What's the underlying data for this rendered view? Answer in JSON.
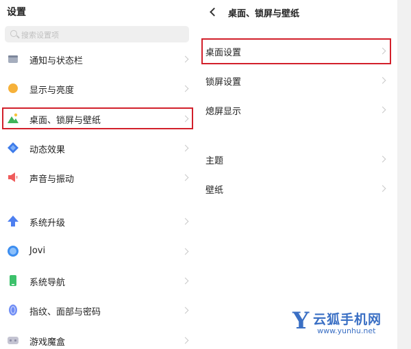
{
  "settings": {
    "title": "设置",
    "search_placeholder": "搜索设置项",
    "items": [
      {
        "label": "通知与状态栏",
        "icon": "notification-icon",
        "color": "#8a93a6"
      },
      {
        "label": "显示与亮度",
        "icon": "brightness-icon",
        "color": "#f6b13a"
      },
      {
        "label": "桌面、锁屏与壁纸",
        "icon": "wallpaper-icon",
        "color": "#3fb45a"
      },
      {
        "label": "动态效果",
        "icon": "motion-effect-icon",
        "color": "#3d7bea"
      },
      {
        "label": "声音与振动",
        "icon": "speaker-icon",
        "color": "#ef5b5b"
      },
      {
        "label": "系统升级",
        "icon": "upgrade-arrow-icon",
        "color": "#4d7ff0"
      },
      {
        "label": "Jovi",
        "icon": "jovi-icon",
        "color": "#3d8ef0"
      },
      {
        "label": "系统导航",
        "icon": "navigation-icon",
        "color": "#3cc16b"
      },
      {
        "label": "指纹、面部与密码",
        "icon": "fingerprint-icon",
        "color": "#6f8df5"
      },
      {
        "label": "游戏魔盒",
        "icon": "game-box-icon",
        "color": "#b9b9c8"
      }
    ]
  },
  "detail": {
    "title": "桌面、锁屏与壁纸",
    "items": [
      {
        "label": "桌面设置"
      },
      {
        "label": "锁屏设置"
      },
      {
        "label": "熄屏显示"
      },
      {
        "label": "主题"
      },
      {
        "label": "壁纸"
      }
    ]
  },
  "watermark": {
    "logo_letter": "Y",
    "name": "云狐手机网",
    "url": "www.yunhu.net"
  },
  "colors": {
    "highlight": "#d21f2a",
    "brand": "#3a6fc4"
  }
}
